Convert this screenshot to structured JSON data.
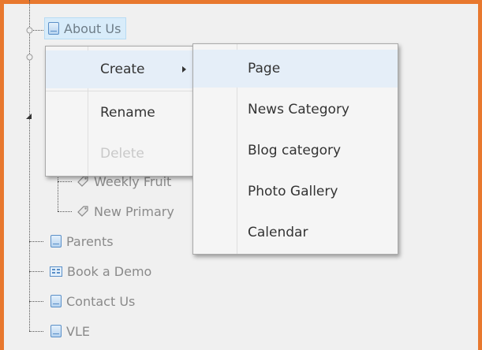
{
  "tree": {
    "items": [
      {
        "label": "About Us",
        "icon": "page-icon",
        "selected": true
      },
      {
        "label": "Weekly Fruit",
        "icon": "tag-icon"
      },
      {
        "label": "New Primary",
        "icon": "tag-icon"
      },
      {
        "label": "Parents",
        "icon": "page-icon"
      },
      {
        "label": "Book a Demo",
        "icon": "form-icon"
      },
      {
        "label": "Contact Us",
        "icon": "page-icon"
      },
      {
        "label": "VLE",
        "icon": "page-icon"
      }
    ]
  },
  "context_menu": {
    "create": "Create",
    "rename": "Rename",
    "delete": "Delete"
  },
  "create_submenu": {
    "items": [
      "Page",
      "News Category",
      "Blog category",
      "Photo Gallery",
      "Calendar"
    ]
  },
  "colors": {
    "frame": "#e8782e",
    "selected_bg": "#d8ecfa",
    "menu_hover": "#e5eef8"
  }
}
